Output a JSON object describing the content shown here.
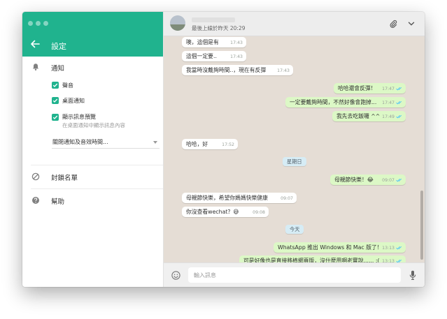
{
  "colors": {
    "header_green": "#20b38e",
    "bubble_out": "#dcf8c6",
    "bubble_in": "#ffffff",
    "chat_bg": "#e5ddd5",
    "date_chip": "#d6ecf5"
  },
  "settings": {
    "title": "設定",
    "notifications": {
      "title": "通知",
      "options": [
        {
          "label": "聲音",
          "checked": true
        },
        {
          "label": "桌面通知",
          "checked": true
        },
        {
          "label": "顯示訊息預覽",
          "sub": "在桌面通知中顯示訊息內容",
          "checked": true
        }
      ],
      "dropdown_value": "關閉通知及音效時間..."
    },
    "blocked": "封鎖名單",
    "help": "幫助"
  },
  "chat": {
    "last_seen": "最後上線於昨天 20:29",
    "messages": [
      {
        "dir": "in",
        "text": "噢，這個是有",
        "time": "17:43"
      },
      {
        "dir": "in",
        "text": "這個一定要..",
        "time": "17:43"
      },
      {
        "dir": "in",
        "text": "我當時沒戴夠時間..，現在有反彈",
        "time": "17:43"
      },
      {
        "dir": "out",
        "text": "哈哈還會反彈！",
        "time": "17:47"
      },
      {
        "dir": "out",
        "text": "一定要戴夠時間，不然好像會跑掉...",
        "time": "17:47"
      },
      {
        "dir": "out",
        "text": "我先去吃飯囉 ^^",
        "time": "17:49"
      },
      {
        "dir": "in",
        "text": "哈哈，好",
        "time": "17:52"
      },
      {
        "dir": "out",
        "text": "母親節快樂！😂",
        "time": "09:07"
      },
      {
        "dir": "in",
        "text": "母親節快樂，希望你媽媽快樂健康",
        "time": "09:07"
      },
      {
        "dir": "in",
        "text": "你沒查看wechat？😅",
        "time": "09:08"
      },
      {
        "dir": "out",
        "text": "WhatsApp 推出 Windows 和 Mac 版了！",
        "time": "13:13"
      },
      {
        "dir": "out",
        "text": "可是好像也是直接移植網頁版，沒什麼用啊老實說...... :(",
        "time": "13:13"
      }
    ],
    "date_labels": [
      "星期日",
      "今天"
    ],
    "input_placeholder": "輸入訊息"
  },
  "icons": {
    "back": "arrow-left-icon",
    "notifications": "bell-icon",
    "blocked": "block-icon",
    "help": "help-icon",
    "attach": "paperclip-icon",
    "menu": "chevron-down-icon",
    "emoji": "smiley-icon",
    "mic": "microphone-icon",
    "read_receipt": "double-check-icon"
  }
}
